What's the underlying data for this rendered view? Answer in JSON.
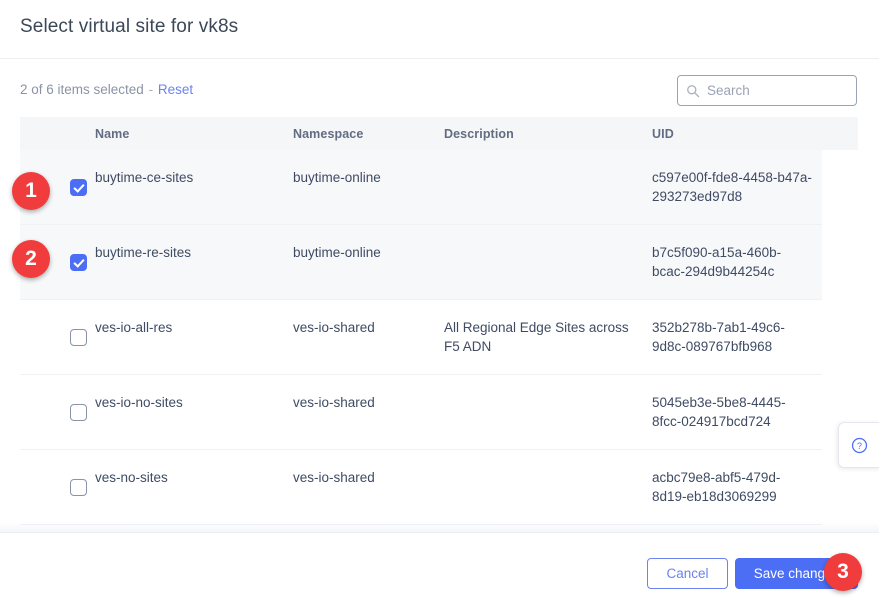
{
  "dialog": {
    "title": "Select virtual site for vk8s"
  },
  "toolbar": {
    "selection_prefix": "2 of 6 items selected",
    "separator": "-",
    "reset_label": "Reset",
    "selected_count": 2,
    "total_count": 6
  },
  "search": {
    "value": "",
    "placeholder": "Search",
    "icon": "search-icon"
  },
  "table": {
    "columns": [
      {
        "key": "name",
        "label": "Name"
      },
      {
        "key": "namespace",
        "label": "Namespace"
      },
      {
        "key": "description",
        "label": "Description"
      },
      {
        "key": "uid",
        "label": "UID"
      }
    ],
    "rows": [
      {
        "selected": true,
        "name": "buytime-ce-sites",
        "namespace": "buytime-online",
        "description": "",
        "uid": "c597e00f-fde8-4458-b47a-293273ed97d8"
      },
      {
        "selected": true,
        "name": "buytime-re-sites",
        "namespace": "buytime-online",
        "description": "",
        "uid": "b7c5f090-a15a-460b-bcac-294d9b44254c"
      },
      {
        "selected": false,
        "name": "ves-io-all-res",
        "namespace": "ves-io-shared",
        "description": "All Regional Edge Sites across F5 ADN",
        "uid": "352b278b-7ab1-49c6-9d8c-089767bfb968"
      },
      {
        "selected": false,
        "name": "ves-io-no-sites",
        "namespace": "ves-io-shared",
        "description": "",
        "uid": "5045eb3e-5be8-4445-8fcc-024917bcd724"
      },
      {
        "selected": false,
        "name": "ves-no-sites",
        "namespace": "ves-io-shared",
        "description": "",
        "uid": "acbc79e8-abf5-479d-8d19-eb18d3069299"
      }
    ]
  },
  "footer": {
    "cancel_label": "Cancel",
    "save_label": "Save changes"
  },
  "help": {
    "icon": "question-circle-icon"
  },
  "annotations": {
    "badges": [
      {
        "id": "1",
        "label": "1"
      },
      {
        "id": "2",
        "label": "2"
      },
      {
        "id": "3",
        "label": "3"
      }
    ]
  },
  "colors": {
    "accent": "#4c6ef5",
    "link": "#6b82ef",
    "badge": "#f03c3c",
    "header_bg": "#f5f6f8",
    "selected_row_bg": "#f7f8fa",
    "text": "#3f4b63",
    "muted_text": "#8b93a5"
  }
}
